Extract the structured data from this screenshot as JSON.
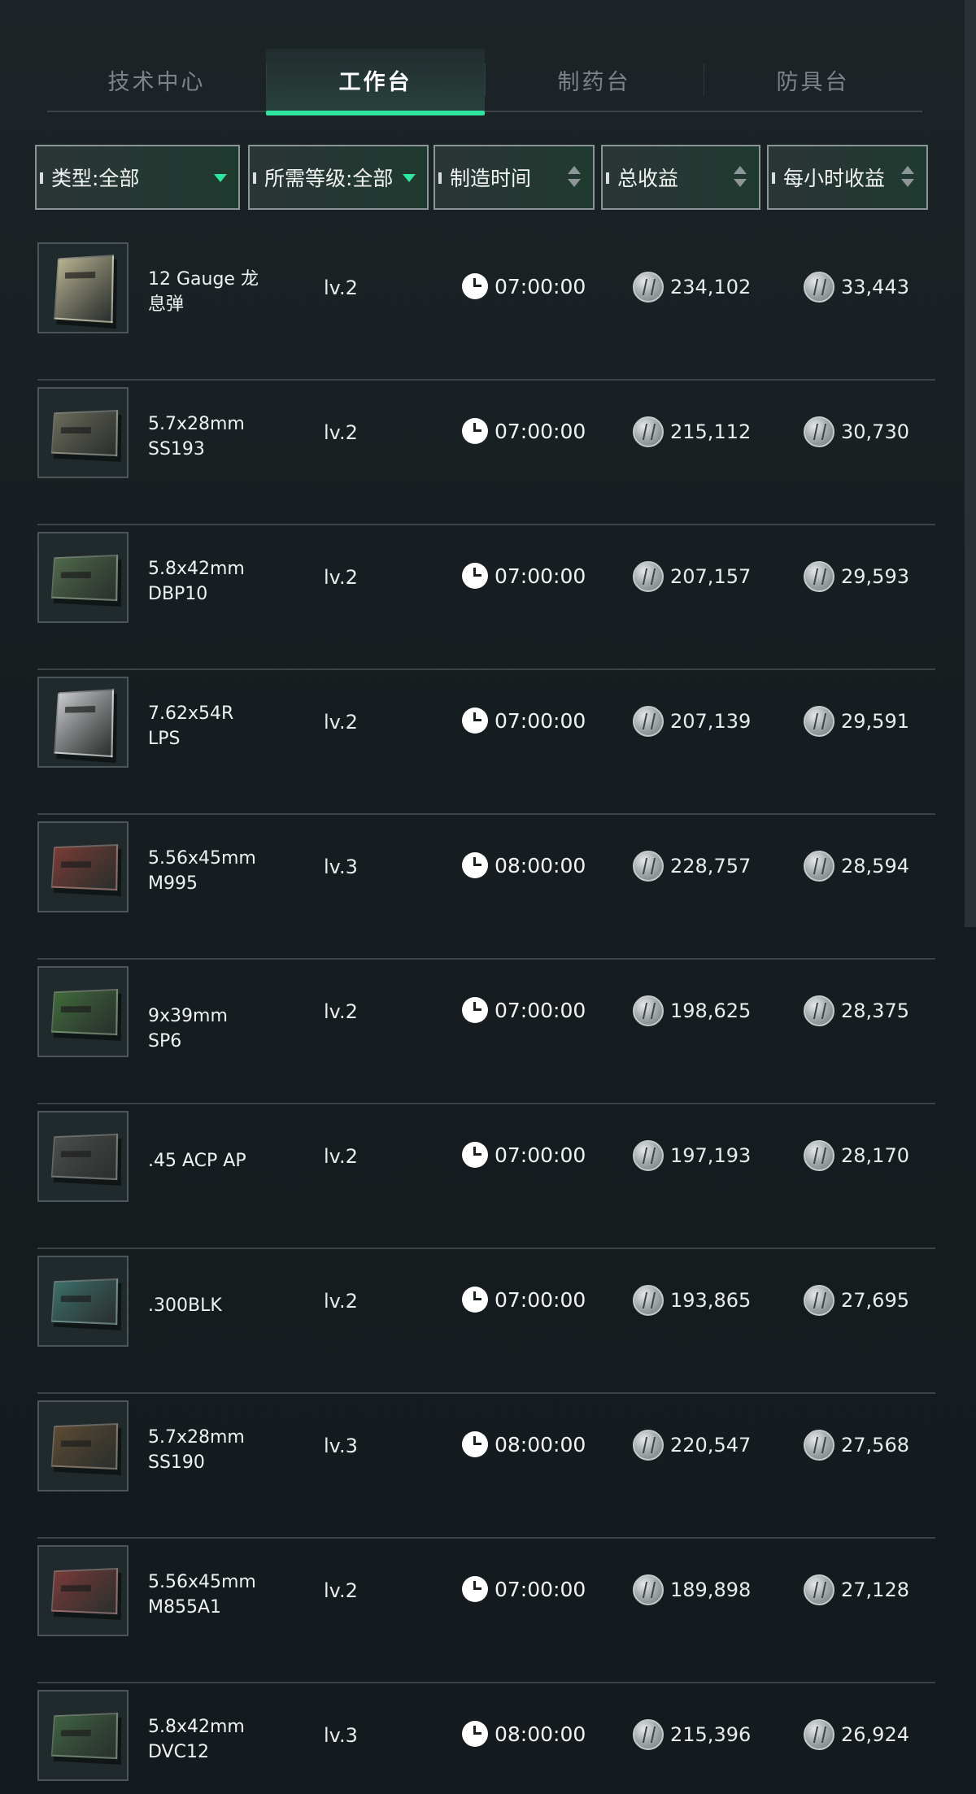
{
  "tabs": [
    {
      "label": "技术中心",
      "active": false
    },
    {
      "label": "工作台",
      "active": true
    },
    {
      "label": "制药台",
      "active": false
    },
    {
      "label": "防具台",
      "active": false
    }
  ],
  "filters": {
    "type": "类型:全部",
    "level": "所需等级:全部",
    "time": "制造时间",
    "total": "总收益",
    "hourly": "每小时收益"
  },
  "colors": {
    "accent": "#2ee6a0",
    "background": "#161d20",
    "text": "#e6eaea"
  },
  "items": [
    {
      "name": "12 Gauge 龙息弹",
      "level": "lv.2",
      "time": "07:00:00",
      "total": "234,102",
      "hourly": "33,443",
      "box": "#b8b291"
    },
    {
      "name": "5.7x28mm SS193",
      "level": "lv.2",
      "time": "07:00:00",
      "total": "215,112",
      "hourly": "30,730",
      "box": "#6b6b5a"
    },
    {
      "name": "5.8x42mm DBP10",
      "level": "lv.2",
      "time": "07:00:00",
      "total": "207,157",
      "hourly": "29,593",
      "box": "#4f6a4a"
    },
    {
      "name": "7.62x54R LPS",
      "level": "lv.2",
      "time": "07:00:00",
      "total": "207,139",
      "hourly": "29,591",
      "box": "#c8cacb"
    },
    {
      "name": "5.56x45mm M995",
      "level": "lv.3",
      "time": "08:00:00",
      "total": "228,757",
      "hourly": "28,594",
      "box": "#7a3b33"
    },
    {
      "name": "9x39mm SP6",
      "level": "lv.2",
      "time": "07:00:00",
      "total": "198,625",
      "hourly": "28,375",
      "box": "#3f6b3a"
    },
    {
      "name": ".45 ACP AP",
      "level": "lv.2",
      "time": "07:00:00",
      "total": "197,193",
      "hourly": "28,170",
      "box": "#4a4e4c"
    },
    {
      "name": ".300BLK",
      "level": "lv.2",
      "time": "07:00:00",
      "total": "193,865",
      "hourly": "27,695",
      "box": "#3c6f6a"
    },
    {
      "name": "5.7x28mm SS190",
      "level": "lv.3",
      "time": "08:00:00",
      "total": "220,547",
      "hourly": "27,568",
      "box": "#5e4a32"
    },
    {
      "name": "5.56x45mm M855A1",
      "level": "lv.2",
      "time": "07:00:00",
      "total": "189,898",
      "hourly": "27,128",
      "box": "#7a3a38"
    },
    {
      "name": "5.8x42mm DVC12",
      "level": "lv.3",
      "time": "08:00:00",
      "total": "215,396",
      "hourly": "26,924",
      "box": "#3f6342"
    }
  ]
}
